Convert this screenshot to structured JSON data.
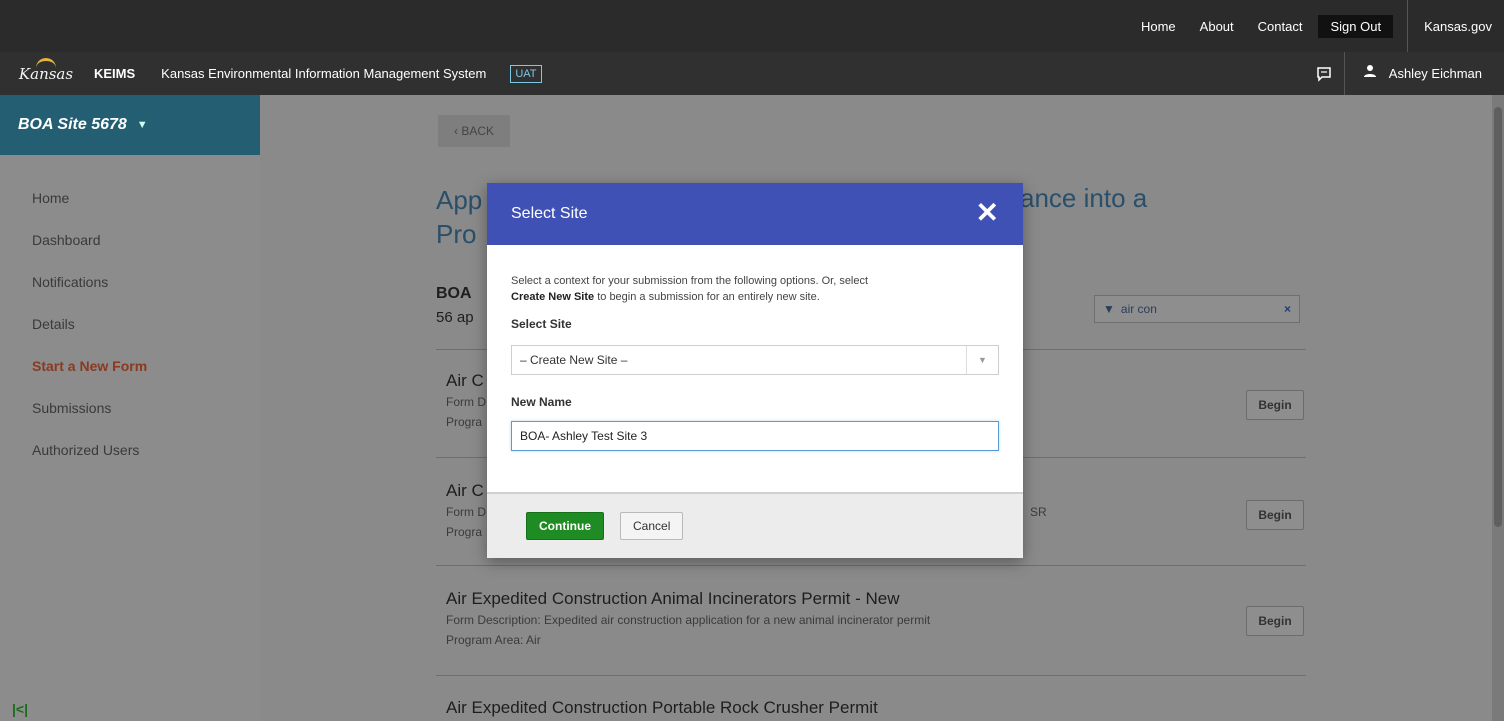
{
  "topnav": {
    "home": "Home",
    "about": "About",
    "contact": "Contact",
    "signout": "Sign Out",
    "kansas_gov": "Kansas.gov"
  },
  "appbar": {
    "logo_text": "Kansas",
    "app_short": "KEIMS",
    "app_full": "Kansas Environmental Information Management System",
    "env_badge": "UAT",
    "user_name": "Ashley Eichman"
  },
  "sidebar": {
    "site_name": "BOA Site 5678",
    "items": [
      {
        "label": "Home"
      },
      {
        "label": "Dashboard"
      },
      {
        "label": "Notifications"
      },
      {
        "label": "Details"
      },
      {
        "label": "Start a New Form"
      },
      {
        "label": "Submissions"
      },
      {
        "label": "Authorized Users"
      }
    ],
    "collapse_glyph": "|<|"
  },
  "main": {
    "back_label": "BACK",
    "title_left": "App",
    "title_left_line2": "Pro",
    "title_right": "ance into a",
    "section_title": "BOA",
    "section_count": "56 ap",
    "filter_value": "air con",
    "forms": [
      {
        "name": "Air C",
        "desc": "Form D",
        "area": "Progra",
        "begin": "Begin"
      },
      {
        "name": "Air C",
        "desc": "Form D",
        "extra": "SR",
        "area": "Progra",
        "begin": "Begin"
      },
      {
        "name": "Air Expedited Construction Animal Incinerators Permit - New",
        "desc": "Form Description: Expedited air construction application for a new animal incinerator permit",
        "area": "Program Area: Air",
        "begin": "Begin"
      },
      {
        "name": "Air Expedited Construction Portable Rock Crusher Permit"
      }
    ]
  },
  "modal": {
    "title": "Select Site",
    "intro_line1": "Select a context for your submission from the following options. Or, select",
    "intro_bold": "Create New Site",
    "intro_line2_rest": " to begin a submission for an entirely new site.",
    "select_label": "Select Site",
    "select_value": "– Create New Site –",
    "name_label": "New Name",
    "name_value": "BOA- Ashley Test Site 3",
    "continue_label": "Continue",
    "cancel_label": "Cancel"
  }
}
